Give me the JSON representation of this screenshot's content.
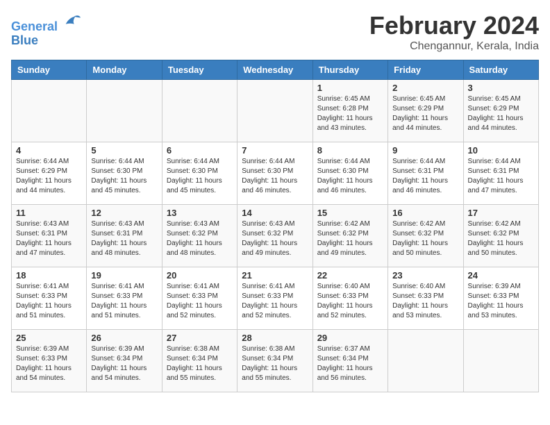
{
  "logo": {
    "line1": "General",
    "line2": "Blue"
  },
  "title": "February 2024",
  "subtitle": "Chengannur, Kerala, India",
  "days_of_week": [
    "Sunday",
    "Monday",
    "Tuesday",
    "Wednesday",
    "Thursday",
    "Friday",
    "Saturday"
  ],
  "weeks": [
    [
      {
        "day": "",
        "info": ""
      },
      {
        "day": "",
        "info": ""
      },
      {
        "day": "",
        "info": ""
      },
      {
        "day": "",
        "info": ""
      },
      {
        "day": "1",
        "info": "Sunrise: 6:45 AM\nSunset: 6:28 PM\nDaylight: 11 hours and 43 minutes."
      },
      {
        "day": "2",
        "info": "Sunrise: 6:45 AM\nSunset: 6:29 PM\nDaylight: 11 hours and 44 minutes."
      },
      {
        "day": "3",
        "info": "Sunrise: 6:45 AM\nSunset: 6:29 PM\nDaylight: 11 hours and 44 minutes."
      }
    ],
    [
      {
        "day": "4",
        "info": "Sunrise: 6:44 AM\nSunset: 6:29 PM\nDaylight: 11 hours and 44 minutes."
      },
      {
        "day": "5",
        "info": "Sunrise: 6:44 AM\nSunset: 6:30 PM\nDaylight: 11 hours and 45 minutes."
      },
      {
        "day": "6",
        "info": "Sunrise: 6:44 AM\nSunset: 6:30 PM\nDaylight: 11 hours and 45 minutes."
      },
      {
        "day": "7",
        "info": "Sunrise: 6:44 AM\nSunset: 6:30 PM\nDaylight: 11 hours and 46 minutes."
      },
      {
        "day": "8",
        "info": "Sunrise: 6:44 AM\nSunset: 6:30 PM\nDaylight: 11 hours and 46 minutes."
      },
      {
        "day": "9",
        "info": "Sunrise: 6:44 AM\nSunset: 6:31 PM\nDaylight: 11 hours and 46 minutes."
      },
      {
        "day": "10",
        "info": "Sunrise: 6:44 AM\nSunset: 6:31 PM\nDaylight: 11 hours and 47 minutes."
      }
    ],
    [
      {
        "day": "11",
        "info": "Sunrise: 6:43 AM\nSunset: 6:31 PM\nDaylight: 11 hours and 47 minutes."
      },
      {
        "day": "12",
        "info": "Sunrise: 6:43 AM\nSunset: 6:31 PM\nDaylight: 11 hours and 48 minutes."
      },
      {
        "day": "13",
        "info": "Sunrise: 6:43 AM\nSunset: 6:32 PM\nDaylight: 11 hours and 48 minutes."
      },
      {
        "day": "14",
        "info": "Sunrise: 6:43 AM\nSunset: 6:32 PM\nDaylight: 11 hours and 49 minutes."
      },
      {
        "day": "15",
        "info": "Sunrise: 6:42 AM\nSunset: 6:32 PM\nDaylight: 11 hours and 49 minutes."
      },
      {
        "day": "16",
        "info": "Sunrise: 6:42 AM\nSunset: 6:32 PM\nDaylight: 11 hours and 50 minutes."
      },
      {
        "day": "17",
        "info": "Sunrise: 6:42 AM\nSunset: 6:32 PM\nDaylight: 11 hours and 50 minutes."
      }
    ],
    [
      {
        "day": "18",
        "info": "Sunrise: 6:41 AM\nSunset: 6:33 PM\nDaylight: 11 hours and 51 minutes."
      },
      {
        "day": "19",
        "info": "Sunrise: 6:41 AM\nSunset: 6:33 PM\nDaylight: 11 hours and 51 minutes."
      },
      {
        "day": "20",
        "info": "Sunrise: 6:41 AM\nSunset: 6:33 PM\nDaylight: 11 hours and 52 minutes."
      },
      {
        "day": "21",
        "info": "Sunrise: 6:41 AM\nSunset: 6:33 PM\nDaylight: 11 hours and 52 minutes."
      },
      {
        "day": "22",
        "info": "Sunrise: 6:40 AM\nSunset: 6:33 PM\nDaylight: 11 hours and 52 minutes."
      },
      {
        "day": "23",
        "info": "Sunrise: 6:40 AM\nSunset: 6:33 PM\nDaylight: 11 hours and 53 minutes."
      },
      {
        "day": "24",
        "info": "Sunrise: 6:39 AM\nSunset: 6:33 PM\nDaylight: 11 hours and 53 minutes."
      }
    ],
    [
      {
        "day": "25",
        "info": "Sunrise: 6:39 AM\nSunset: 6:33 PM\nDaylight: 11 hours and 54 minutes."
      },
      {
        "day": "26",
        "info": "Sunrise: 6:39 AM\nSunset: 6:34 PM\nDaylight: 11 hours and 54 minutes."
      },
      {
        "day": "27",
        "info": "Sunrise: 6:38 AM\nSunset: 6:34 PM\nDaylight: 11 hours and 55 minutes."
      },
      {
        "day": "28",
        "info": "Sunrise: 6:38 AM\nSunset: 6:34 PM\nDaylight: 11 hours and 55 minutes."
      },
      {
        "day": "29",
        "info": "Sunrise: 6:37 AM\nSunset: 6:34 PM\nDaylight: 11 hours and 56 minutes."
      },
      {
        "day": "",
        "info": ""
      },
      {
        "day": "",
        "info": ""
      }
    ]
  ]
}
